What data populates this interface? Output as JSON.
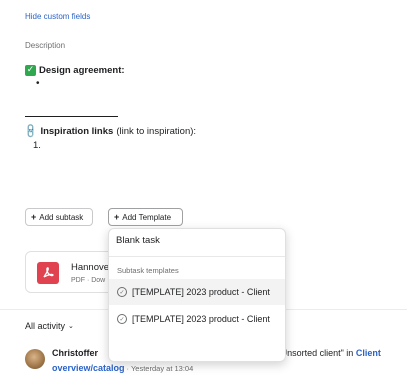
{
  "fields": {
    "hide_custom_fields": "Hide custom fields"
  },
  "description": {
    "label": "Description",
    "design_emoji": "✓",
    "design_heading": "Design agreement:",
    "bullet": "•",
    "link_emoji": "🔗",
    "inspiration_heading": "Inspiration links",
    "inspiration_note": "(link to inspiration):",
    "list_item": "1."
  },
  "actions": {
    "add_subtask": "Add subtask",
    "add_template": "Add Template"
  },
  "attachment": {
    "name": "Hannove",
    "meta": "PDF · Dow"
  },
  "dropdown": {
    "blank_task": "Blank task",
    "section_header": "Subtask templates",
    "templates": [
      {
        "label": "[TEMPLATE] 2023 product - Client"
      },
      {
        "label": "[TEMPLATE] 2023 product - Client"
      }
    ]
  },
  "activity": {
    "filter_label": "All activity",
    "actor": "Christoffer",
    "action_text": "created this task using \"[TEMPLATE] Unsorted client\" in",
    "project_part1": "Client",
    "project_part2": "overview/catalog",
    "timestamp": "· Yesterday at 13:04"
  },
  "colors": {
    "link": "#2b63c8",
    "pdf": "#e0424f",
    "check": "#2fa84f"
  }
}
